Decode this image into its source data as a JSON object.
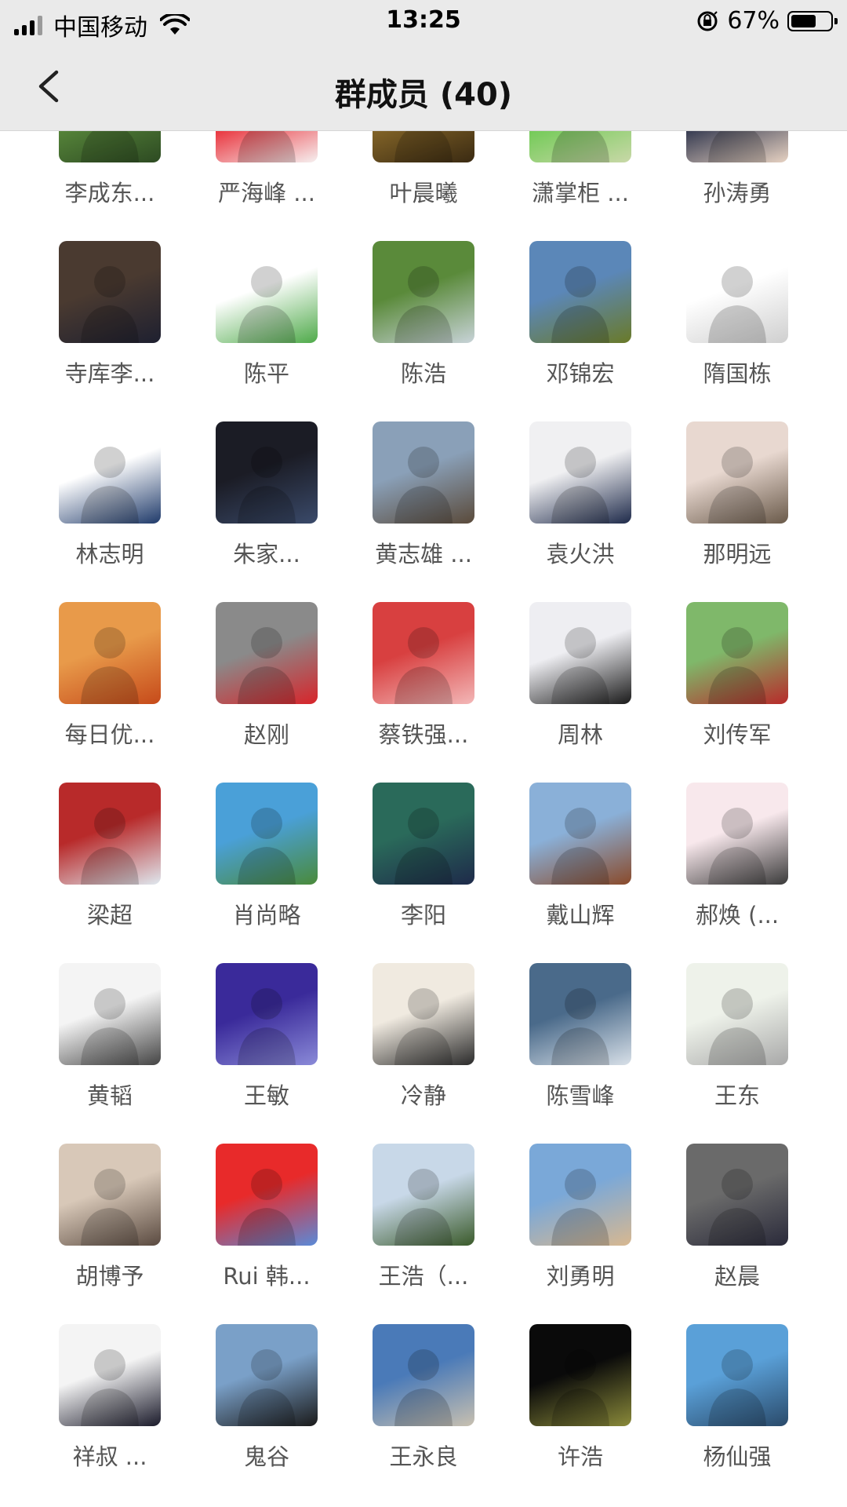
{
  "status_bar": {
    "carrier": "中国移动",
    "time": "13:25",
    "battery_percent": "67%",
    "battery_level": 0.67
  },
  "nav": {
    "title": "群成员 (40)"
  },
  "members": [
    {
      "name": "李成东...",
      "colors": [
        "#5a8a3c",
        "#2d4a22"
      ],
      "icon": "golfer-avatar"
    },
    {
      "name": "严海峰 ...",
      "colors": [
        "#e8202a",
        "#f6f0f0"
      ],
      "icon": "cartoon-avatar"
    },
    {
      "name": "叶晨曦",
      "colors": [
        "#8a6a2a",
        "#3a2a12"
      ],
      "icon": "statue-avatar"
    },
    {
      "name": "潇掌柜 ...",
      "colors": [
        "#69c94e",
        "#c9d8a8"
      ],
      "icon": "child-sunglasses-avatar"
    },
    {
      "name": "孙涛勇",
      "colors": [
        "#222a44",
        "#e7d2c2"
      ],
      "icon": "portrait-avatar"
    },
    {
      "name": "寺库李...",
      "colors": [
        "#4a3a30",
        "#1e2030"
      ],
      "icon": "portrait-avatar"
    },
    {
      "name": "陈平",
      "colors": [
        "#ffffff",
        "#4faa4a"
      ],
      "icon": "number-art-avatar"
    },
    {
      "name": "陈浩",
      "colors": [
        "#5a8a3a",
        "#c8d3d8"
      ],
      "icon": "tree-avatar"
    },
    {
      "name": "邓锦宏",
      "colors": [
        "#5b87b8",
        "#6a7a28"
      ],
      "icon": "landscape-avatar"
    },
    {
      "name": "隋国栋",
      "colors": [
        "#ffffff",
        "#cfcfcf"
      ],
      "icon": "sketch-avatar"
    },
    {
      "name": "林志明",
      "colors": [
        "#ffffff",
        "#1f3a6a"
      ],
      "icon": "cartoon-avatar"
    },
    {
      "name": "朱家...",
      "colors": [
        "#1b1c25",
        "#3a4a6a"
      ],
      "icon": "speaker-avatar"
    },
    {
      "name": "黄志雄 ...",
      "colors": [
        "#8aa0b8",
        "#5a4a3a"
      ],
      "icon": "couple-avatar"
    },
    {
      "name": "袁火洪",
      "colors": [
        "#f0f0f2",
        "#1e2a4a"
      ],
      "icon": "portrait-avatar"
    },
    {
      "name": "那明远",
      "colors": [
        "#e8d8d0",
        "#6a5a4a"
      ],
      "icon": "photo-avatar"
    },
    {
      "name": "每日优...",
      "colors": [
        "#e89a4a",
        "#c64a1a"
      ],
      "icon": "painting-avatar"
    },
    {
      "name": "赵刚",
      "colors": [
        "#8a8a8a",
        "#d8242a"
      ],
      "icon": "street-avatar"
    },
    {
      "name": "蔡铁强...",
      "colors": [
        "#d84040",
        "#f3b7b7"
      ],
      "icon": "baby-avatar"
    },
    {
      "name": "周林",
      "colors": [
        "#eeeef2",
        "#1a1a1a"
      ],
      "icon": "standing-man-avatar"
    },
    {
      "name": "刘传军",
      "colors": [
        "#7fb86a",
        "#b82a2a"
      ],
      "icon": "vintage-car-avatar"
    },
    {
      "name": "梁超",
      "colors": [
        "#b82a2a",
        "#dfe8ef"
      ],
      "icon": "monkey-king-avatar"
    },
    {
      "name": "肖尚略",
      "colors": [
        "#4aa0d8",
        "#4a8a3a"
      ],
      "icon": "man-outdoor-avatar"
    },
    {
      "name": "李阳",
      "colors": [
        "#2a6a5a",
        "#1e2a4a"
      ],
      "icon": "kid-cap-avatar"
    },
    {
      "name": "戴山辉",
      "colors": [
        "#8ab0d8",
        "#8a4a2a"
      ],
      "icon": "pagoda-avatar"
    },
    {
      "name": "郝焕 (...",
      "colors": [
        "#f8e8ec",
        "#3a3a3a"
      ],
      "icon": "cartoon-avatar"
    },
    {
      "name": "黄韬",
      "colors": [
        "#f4f4f4",
        "#444444"
      ],
      "icon": "panda-avatar"
    },
    {
      "name": "王敏",
      "colors": [
        "#3a2a9a",
        "#8a8ad8"
      ],
      "icon": "hello-idol-avatar"
    },
    {
      "name": "冷静",
      "colors": [
        "#f0eae0",
        "#2a2a2a"
      ],
      "icon": "calligraphy-avatar"
    },
    {
      "name": "陈雪峰",
      "colors": [
        "#4a6a8a",
        "#d8e0e8"
      ],
      "icon": "ski-avatar"
    },
    {
      "name": "王东",
      "colors": [
        "#eef2ea",
        "#a8a8a8"
      ],
      "icon": "cat-fish-avatar"
    },
    {
      "name": "胡博予",
      "colors": [
        "#d8c8b8",
        "#5a4a40"
      ],
      "icon": "family-avatar"
    },
    {
      "name": "Rui 韩...",
      "colors": [
        "#e82a2a",
        "#5a8ad8"
      ],
      "icon": "pixel-avatar"
    },
    {
      "name": "王浩（...",
      "colors": [
        "#c8d8e8",
        "#3a5a2a"
      ],
      "icon": "man-outdoor-avatar"
    },
    {
      "name": "刘勇明",
      "colors": [
        "#7aa8d8",
        "#d8b890"
      ],
      "icon": "man-sunglasses-avatar"
    },
    {
      "name": "赵晨",
      "colors": [
        "#6a6a6a",
        "#2a2a3a"
      ],
      "icon": "toddler-avatar"
    },
    {
      "name": "祥叔 ...",
      "colors": [
        "#f4f4f4",
        "#1a1a2a"
      ],
      "icon": "portrait-avatar"
    },
    {
      "name": "鬼谷",
      "colors": [
        "#7aa0c8",
        "#1a1a1a"
      ],
      "icon": "man-bridge-avatar"
    },
    {
      "name": "王永良",
      "colors": [
        "#4a7ab8",
        "#c8c0b0"
      ],
      "icon": "seaside-avatar"
    },
    {
      "name": "许浩",
      "colors": [
        "#0a0a0a",
        "#8a8a3a"
      ],
      "icon": "moon-avatar"
    },
    {
      "name": "杨仙强",
      "colors": [
        "#5aa0d8",
        "#2a4a6a"
      ],
      "icon": "lake-avatar"
    }
  ]
}
